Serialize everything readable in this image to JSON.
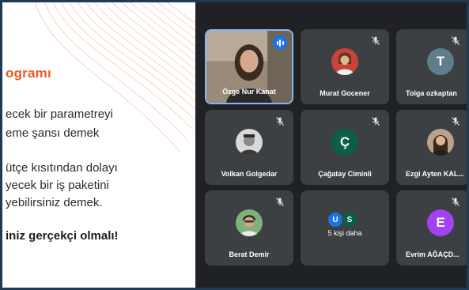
{
  "slide": {
    "title": "ogramı",
    "lines": [
      "ecek bir parametreyi",
      "eme şansı demek",
      "ütçe kısıtından dolayı",
      "yecek bir iş paketini",
      "yebilirsiniz demek."
    ],
    "emphasis": "iniz gerçekçi olmalı!",
    "accent_color": "#ef5a24"
  },
  "meeting": {
    "participants": [
      {
        "name": "Özge Nur Kanat",
        "speaking": true,
        "muted": false,
        "avatar_type": "video"
      },
      {
        "name": "Murat Gocener",
        "muted": true,
        "avatar_type": "photo"
      },
      {
        "name": "Tolga ozkaptan",
        "initial": "T",
        "avatar_color": "#607d8b",
        "muted": true,
        "avatar_type": "initial"
      },
      {
        "name": "Volkan Golgedar",
        "muted": true,
        "avatar_type": "photo"
      },
      {
        "name": "Çağatay Ciminli",
        "initial": "Ç",
        "avatar_color": "#0b5e47",
        "muted": true,
        "avatar_type": "initial"
      },
      {
        "name": "Ezgi Ayten KAL...",
        "muted": true,
        "avatar_type": "photo"
      },
      {
        "name": "Berat Demir",
        "muted": true,
        "avatar_type": "photo"
      },
      {
        "name": "5 kişi daha",
        "avatar_type": "group",
        "mini_initials": [
          "U",
          "S"
        ],
        "mini_colors": [
          "#1a73e8",
          "#0b5e47"
        ]
      },
      {
        "name": "Evrim AĞAÇD...",
        "initial": "E",
        "avatar_color": "#a142f4",
        "muted": true,
        "avatar_type": "initial"
      }
    ]
  },
  "icons": {
    "mute": "mic-off-icon",
    "speaking": "audio-wave-icon"
  }
}
